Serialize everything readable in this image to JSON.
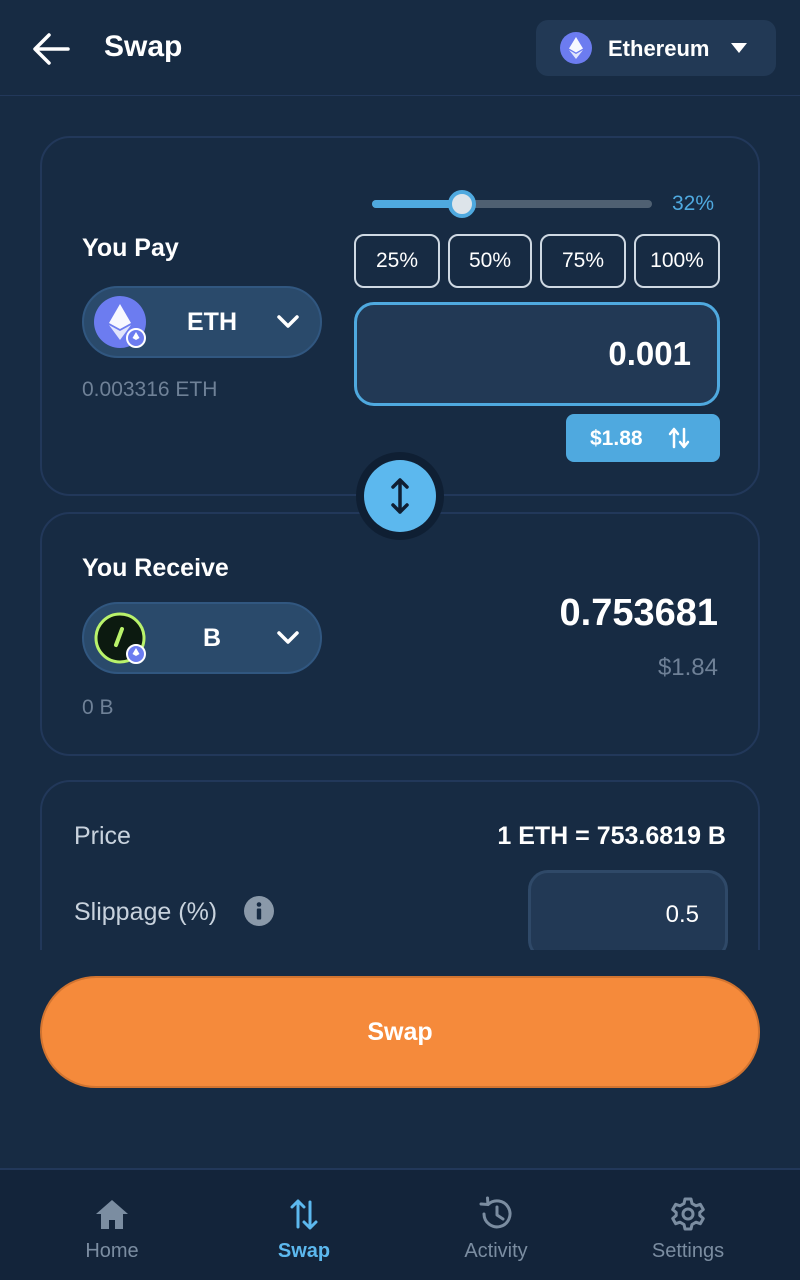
{
  "header": {
    "title": "Swap",
    "network": "Ethereum"
  },
  "pay": {
    "title": "You Pay",
    "token": "ETH",
    "balance": "0.003316 ETH",
    "slider_percent": 32,
    "slider_label": "32%",
    "percent_buttons": [
      "25%",
      "50%",
      "75%",
      "100%"
    ],
    "amount": "0.001",
    "usd_value": "$1.88"
  },
  "receive": {
    "title": "You Receive",
    "token": "B",
    "balance": "0 B",
    "amount": "0.753681",
    "usd_value": "$1.84"
  },
  "details": {
    "price_label": "Price",
    "price_value": "1 ETH = 753.6819 B",
    "slippage_label": "Slippage (%)",
    "slippage_value": "0.5"
  },
  "swap_button": "Swap",
  "nav": [
    {
      "label": "Home",
      "icon": "home-icon",
      "active": false
    },
    {
      "label": "Swap",
      "icon": "swap-icon",
      "active": true
    },
    {
      "label": "Activity",
      "icon": "history-icon",
      "active": false
    },
    {
      "label": "Settings",
      "icon": "gear-icon",
      "active": false
    }
  ],
  "colors": {
    "background": "#172b43",
    "accent": "#4fa9df",
    "swap_button": "#f58a3b"
  }
}
